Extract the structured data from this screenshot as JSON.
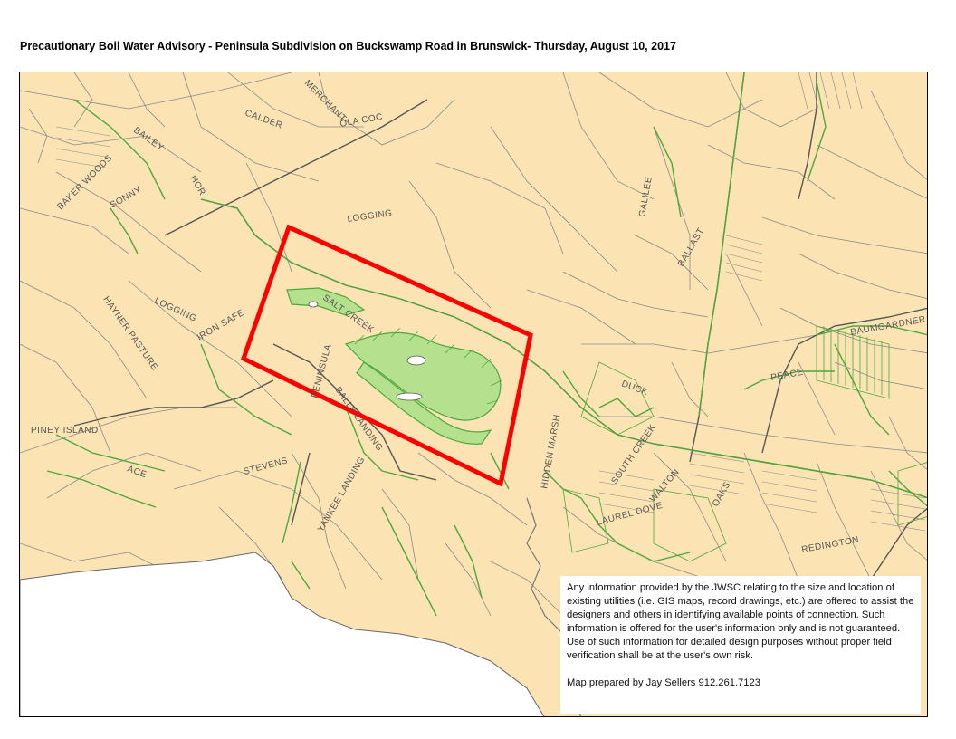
{
  "title": "Precautionary Boil Water Advisory - Peninsula Subdivision on Buckswamp Road  in Brunswick- Thursday, August 10, 2017",
  "colors": {
    "land": "#fbe3b3",
    "parcel_line": "#8a8a8a",
    "water_line": "#4ca83c",
    "subdivision_fill": "#b5e08e",
    "highlight": "#ff0000",
    "water_body": "#ffffff"
  },
  "road_labels": [
    "CALDER",
    "MERCHANT",
    "OLA COC",
    "BAILEY",
    "BAKER WOODS",
    "SONNY",
    "HOR",
    "LOGGING",
    "LOGGING",
    "IRON SAFE",
    "HAYNER PASTURE",
    "SALT CREEK",
    "PENINSULA",
    "BALLY LANDING",
    "PINEY ISLAND",
    "ACE",
    "STEVENS",
    "YANKEE LANDING",
    "HIDDEN MARSH",
    "GALILEE",
    "BAUMGARDNER",
    "PEACE",
    "DUCK",
    "SOUTH CREEK",
    "LAUREL DOVE",
    "REDINGTON",
    "WALTON",
    "BALLAST",
    "OAKS"
  ],
  "disclaimer": {
    "text": "Any information provided by the JWSC relating to the size and location of existing utilities (i.e. GIS maps, record drawings, etc.) are offered to assist the designers and others in identifying available points of connection. Such information is offered for the user's information only and is not guaranteed. Use of such information for detailed design purposes without proper field verification shall be at the user's own risk.",
    "credit": "Map prepared by Jay Sellers 912.261.7123"
  }
}
